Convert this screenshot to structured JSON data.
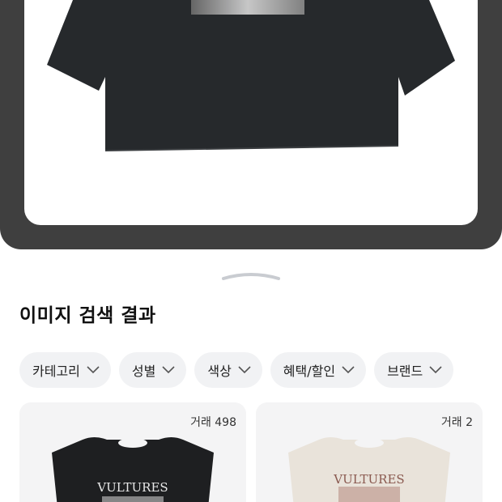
{
  "section_title": "이미지 검색 결과",
  "filters": [
    {
      "label": "카테고리"
    },
    {
      "label": "성별"
    },
    {
      "label": "색상"
    },
    {
      "label": "혜택/할인"
    },
    {
      "label": "브랜드"
    }
  ],
  "results": [
    {
      "trade_count": "거래 498",
      "graphic_text": "VULTURES"
    },
    {
      "trade_count": "거래 2",
      "graphic_text": "VULTURES"
    }
  ]
}
